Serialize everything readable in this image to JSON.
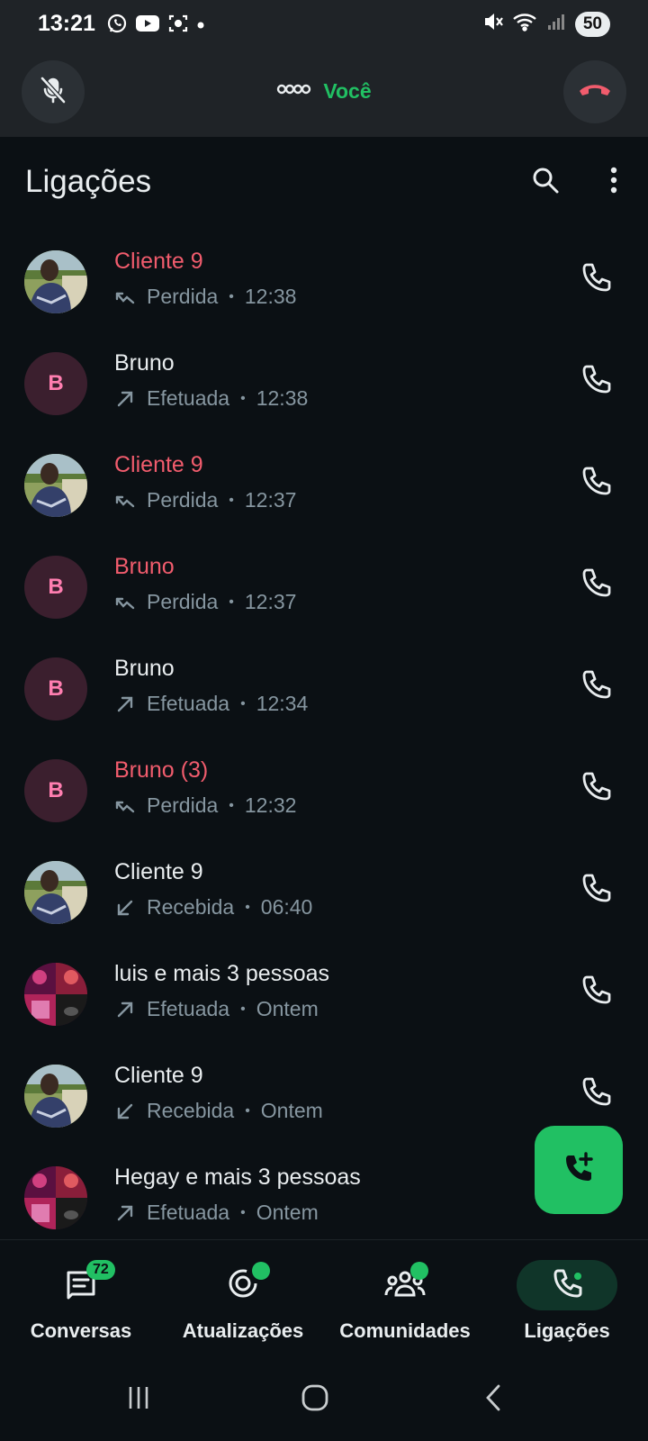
{
  "status_bar": {
    "time": "13:21",
    "battery": "50",
    "icons_left": [
      "whatsapp-icon",
      "youtube-icon",
      "screen-capture-icon",
      "dot-icon"
    ],
    "icons_right": [
      "mute-icon",
      "wifi-icon",
      "signal-icon"
    ]
  },
  "call_banner": {
    "label": "Você",
    "accent": "#21c063",
    "end_call_color": "#f15c6d"
  },
  "header": {
    "title": "Ligações"
  },
  "calls": [
    {
      "name": "Cliente 9",
      "missed": true,
      "avatar": "photo",
      "direction": "missed",
      "status": "Perdida",
      "time": "12:38"
    },
    {
      "name": "Bruno",
      "missed": false,
      "avatar": "letter",
      "initial": "B",
      "direction": "outgoing",
      "status": "Efetuada",
      "time": "12:38"
    },
    {
      "name": "Cliente 9",
      "missed": true,
      "avatar": "photo",
      "direction": "missed",
      "status": "Perdida",
      "time": "12:37"
    },
    {
      "name": "Bruno",
      "missed": true,
      "avatar": "letter",
      "initial": "B",
      "direction": "missed",
      "status": "Perdida",
      "time": "12:37"
    },
    {
      "name": "Bruno",
      "missed": false,
      "avatar": "letter",
      "initial": "B",
      "direction": "outgoing",
      "status": "Efetuada",
      "time": "12:34"
    },
    {
      "name": "Bruno (3)",
      "missed": true,
      "avatar": "letter",
      "initial": "B",
      "direction": "missed",
      "status": "Perdida",
      "time": "12:32"
    },
    {
      "name": "Cliente 9",
      "missed": false,
      "avatar": "photo",
      "direction": "incoming",
      "status": "Recebida",
      "time": "06:40"
    },
    {
      "name": "luis e mais 3 pessoas",
      "missed": false,
      "avatar": "group",
      "direction": "outgoing",
      "status": "Efetuada",
      "time": "Ontem"
    },
    {
      "name": "Cliente 9",
      "missed": false,
      "avatar": "photo",
      "direction": "incoming",
      "status": "Recebida",
      "time": "Ontem"
    },
    {
      "name": "Hegay e mais 3 pessoas",
      "missed": false,
      "avatar": "group",
      "direction": "outgoing",
      "status": "Efetuada",
      "time": "Ontem"
    }
  ],
  "bottom_nav": {
    "items": [
      {
        "label": "Conversas",
        "icon": "chats-icon",
        "badge": "72"
      },
      {
        "label": "Atualizações",
        "icon": "updates-icon",
        "dot": true
      },
      {
        "label": "Comunidades",
        "icon": "communities-icon",
        "dot": true
      },
      {
        "label": "Ligações",
        "icon": "calls-icon",
        "active": true
      }
    ]
  },
  "colors": {
    "background": "#0b1014",
    "accent": "#21c063",
    "missed": "#f15c6d",
    "secondary_text": "#8696a0"
  }
}
